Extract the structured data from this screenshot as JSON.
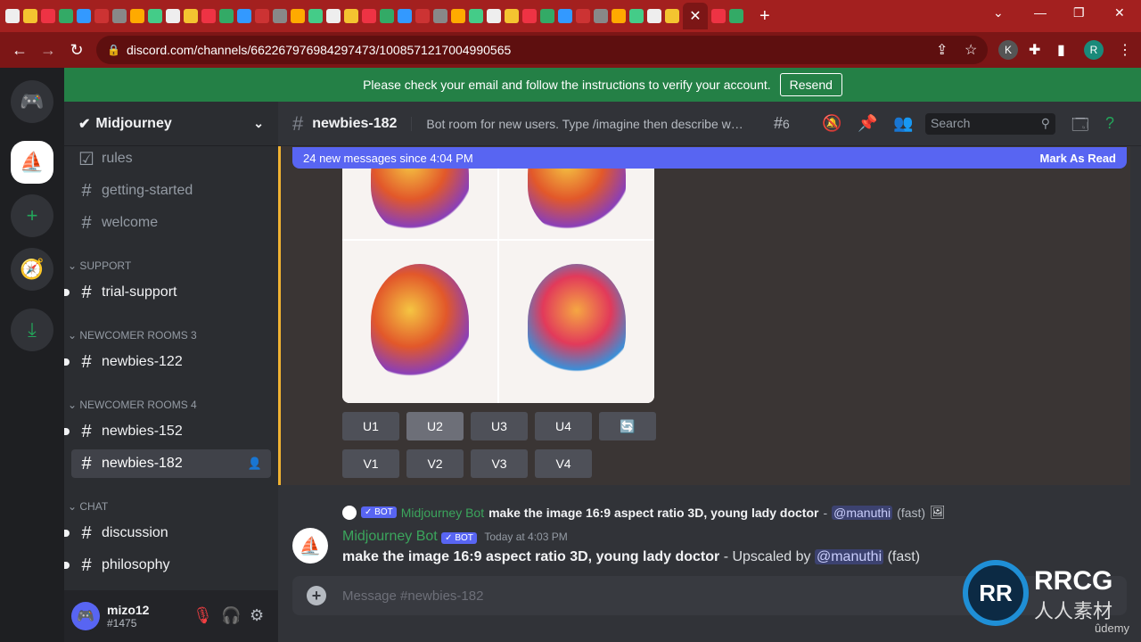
{
  "browser": {
    "url": "discord.com/channels/662267976984297473/1008571217004990565",
    "tab_count_favicons": 40,
    "close_tab": "✕",
    "new_tab": "+",
    "profile_initial_k": "K",
    "profile_initial_r": "R"
  },
  "banner": {
    "text": "Please check your email and follow the instructions to verify your account.",
    "button": "Resend"
  },
  "server": {
    "name": "Midjourney"
  },
  "channels": {
    "top": [
      {
        "name": "rules",
        "icon": "rules-icon"
      },
      {
        "name": "getting-started",
        "icon": "hash"
      },
      {
        "name": "welcome",
        "icon": "hash"
      }
    ],
    "support_label": "SUPPORT",
    "support": [
      {
        "name": "trial-support"
      }
    ],
    "nr3_label": "NEWCOMER ROOMS 3",
    "nr3": [
      {
        "name": "newbies-122"
      }
    ],
    "nr4_label": "NEWCOMER ROOMS 4",
    "nr4": [
      {
        "name": "newbies-152"
      },
      {
        "name": "newbies-182"
      }
    ],
    "chat_label": "CHAT",
    "chat": [
      {
        "name": "discussion"
      },
      {
        "name": "philosophy"
      }
    ]
  },
  "user": {
    "name": "mizo12",
    "tag": "#1475"
  },
  "header": {
    "channel": "newbies-182",
    "topic": "Bot room for new users. Type /imagine then describe what yo...",
    "threads": "6",
    "search_placeholder": "Search"
  },
  "new_messages": {
    "text": "24 new messages since 4:04 PM",
    "action": "Mark As Read"
  },
  "buttons": {
    "upscale": [
      "U1",
      "U2",
      "U3",
      "U4"
    ],
    "variation": [
      "V1",
      "V2",
      "V3",
      "V4"
    ],
    "reroll": "🔄"
  },
  "message": {
    "reply_bot_tag": "✓ BOT",
    "reply_author": "Midjourney Bot",
    "reply_text": "make the image 16:9 aspect ratio 3D, young lady doctor",
    "reply_sep": " - ",
    "reply_mention": "@manuthi",
    "reply_mode": "(fast)",
    "author": "Midjourney Bot",
    "bot_tag": "✓ BOT",
    "timestamp": "Today at 4:03 PM",
    "prompt": "make the image 16:9 aspect ratio 3D, young lady doctor",
    "suffix": " - Upscaled by ",
    "mention": "@manuthi",
    "mode": "(fast)"
  },
  "composer": {
    "placeholder": "Message #newbies-182"
  },
  "watermark": {
    "brand": "RRCG",
    "sub": "人人素材",
    "logo": "RR"
  },
  "udemy": "ûdemy",
  "colors": {
    "accent": "#5865f2",
    "banner": "#248046",
    "bot_green": "#3ba55c",
    "browser": "#a3201f"
  }
}
